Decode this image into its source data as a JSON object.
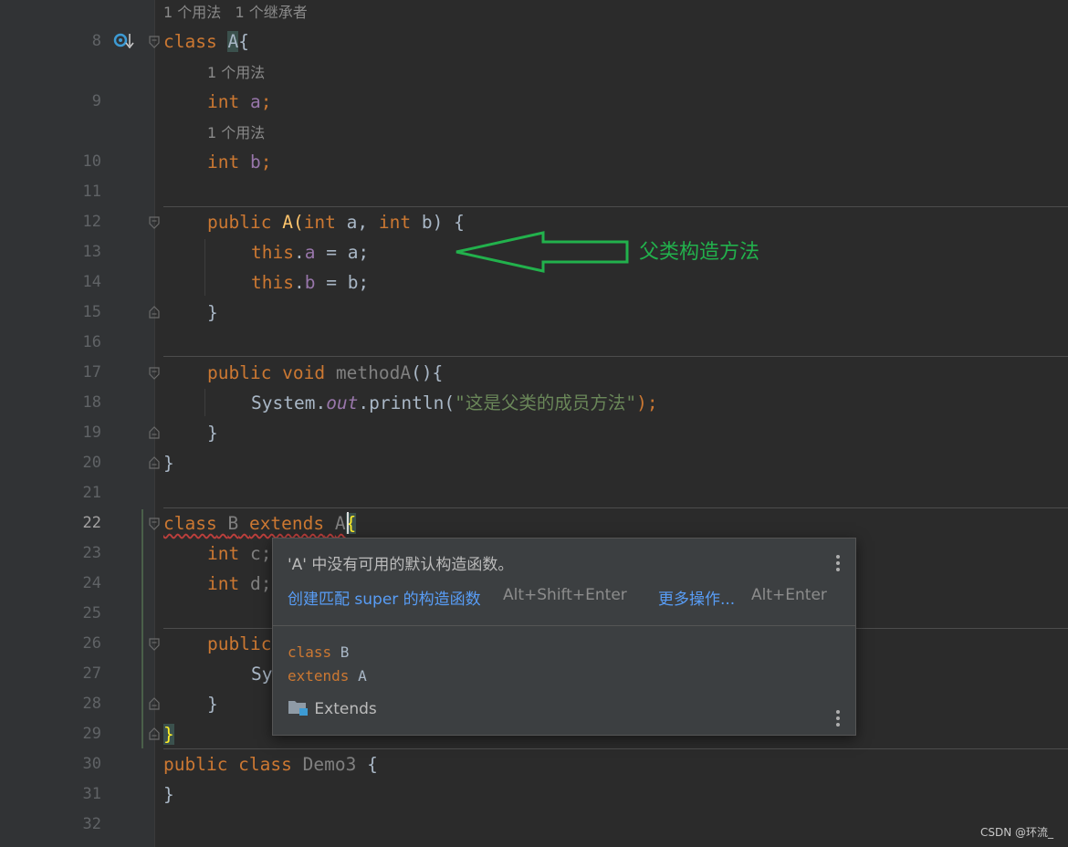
{
  "hints": {
    "line8": "1 个用法   1 个继承者",
    "line9": "1 个用法",
    "line10": "1 个用法"
  },
  "line_numbers": [
    "8",
    "9",
    "10",
    "11",
    "12",
    "13",
    "14",
    "15",
    "16",
    "17",
    "18",
    "19",
    "20",
    "21",
    "22",
    "23",
    "24",
    "25",
    "26",
    "27",
    "28",
    "29",
    "30",
    "31",
    "32"
  ],
  "code": {
    "l8_kw": "class",
    "l8_name": "A",
    "l8_brace": "{",
    "l9_kw": "int",
    "l9_field": "a",
    "l9_semi": ";",
    "l10_kw": "int",
    "l10_field": "b",
    "l10_semi": ";",
    "l12_kw": "public",
    "l12_name": "A(",
    "l12_kw2": "int",
    "l12_p1": " a, ",
    "l12_kw3": "int",
    "l12_p2": " b) {",
    "l13_this": "this",
    "l13_dot": ".",
    "l13_field": "a",
    "l13_rest": " = a;",
    "l14_this": "this",
    "l14_dot": ".",
    "l14_field": "b",
    "l14_rest": " = b;",
    "l15": "}",
    "l17_kw": "public void",
    "l17_name": "methodA",
    "l17_rest": "(){",
    "l18_a": "System.",
    "l18_out": "out",
    "l18_b": ".println(",
    "l18_str": "\"这是父类的成员方法\"",
    "l18_c": ");",
    "l19": "}",
    "l20": "}",
    "l22_kw": "class",
    "l22_name": "B",
    "l22_kw2": "extends",
    "l22_parent": "A",
    "l22_brace": "{",
    "l23_kw": "int",
    "l23_rest": " c;",
    "l24_kw": "int",
    "l24_rest": " d;",
    "l26_kw": "public",
    "l27": "Sy",
    "l28": "}",
    "l29": "}",
    "l30_kw": "public class",
    "l30_name": "Demo3",
    "l30_rest": " {",
    "l31": "}"
  },
  "annotation": {
    "text": "父类构造方法",
    "color": "#22b14c"
  },
  "popup": {
    "message": "'A' 中没有可用的默认构造函数。",
    "action1_label": "创建匹配 super 的构造函数",
    "action1_shortcut": "Alt+Shift+Enter",
    "action2_label": "更多操作...",
    "action2_shortcut": "Alt+Enter",
    "doc_line1_kw": "class",
    "doc_line1_name": " B",
    "doc_line2_kw": "extends",
    "doc_line2_name": " A",
    "extends_label": "Extends"
  },
  "watermark": "CSDN @环流_",
  "colors": {
    "keyword": "#cc7832",
    "field": "#9876aa",
    "string": "#6a8759",
    "link": "#589df6"
  }
}
